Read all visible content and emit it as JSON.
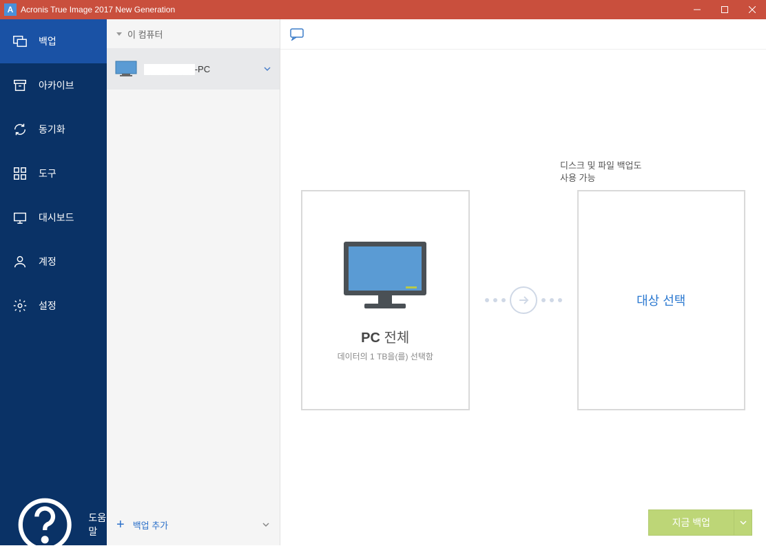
{
  "window": {
    "title": "Acronis True Image 2017 New Generation",
    "logo_letter": "A"
  },
  "sidebar": {
    "items": [
      {
        "label": "백업"
      },
      {
        "label": "아카이브"
      },
      {
        "label": "동기화"
      },
      {
        "label": "도구"
      },
      {
        "label": "대시보드"
      },
      {
        "label": "계정"
      },
      {
        "label": "설정"
      }
    ],
    "help": "도움말"
  },
  "midpanel": {
    "header": "이 컴퓨터",
    "pc_suffix": "-PC",
    "add_backup": "백업 추가"
  },
  "content": {
    "hint_line1": "디스크 및 파일 백업도",
    "hint_line2": "사용 가능",
    "source_title_bold": "PC",
    "source_title_rest": " 전체",
    "source_sub": "데이터의 1 TB을(를) 선택함",
    "dest_label": "대상 선택",
    "action_button": "지금 백업"
  }
}
